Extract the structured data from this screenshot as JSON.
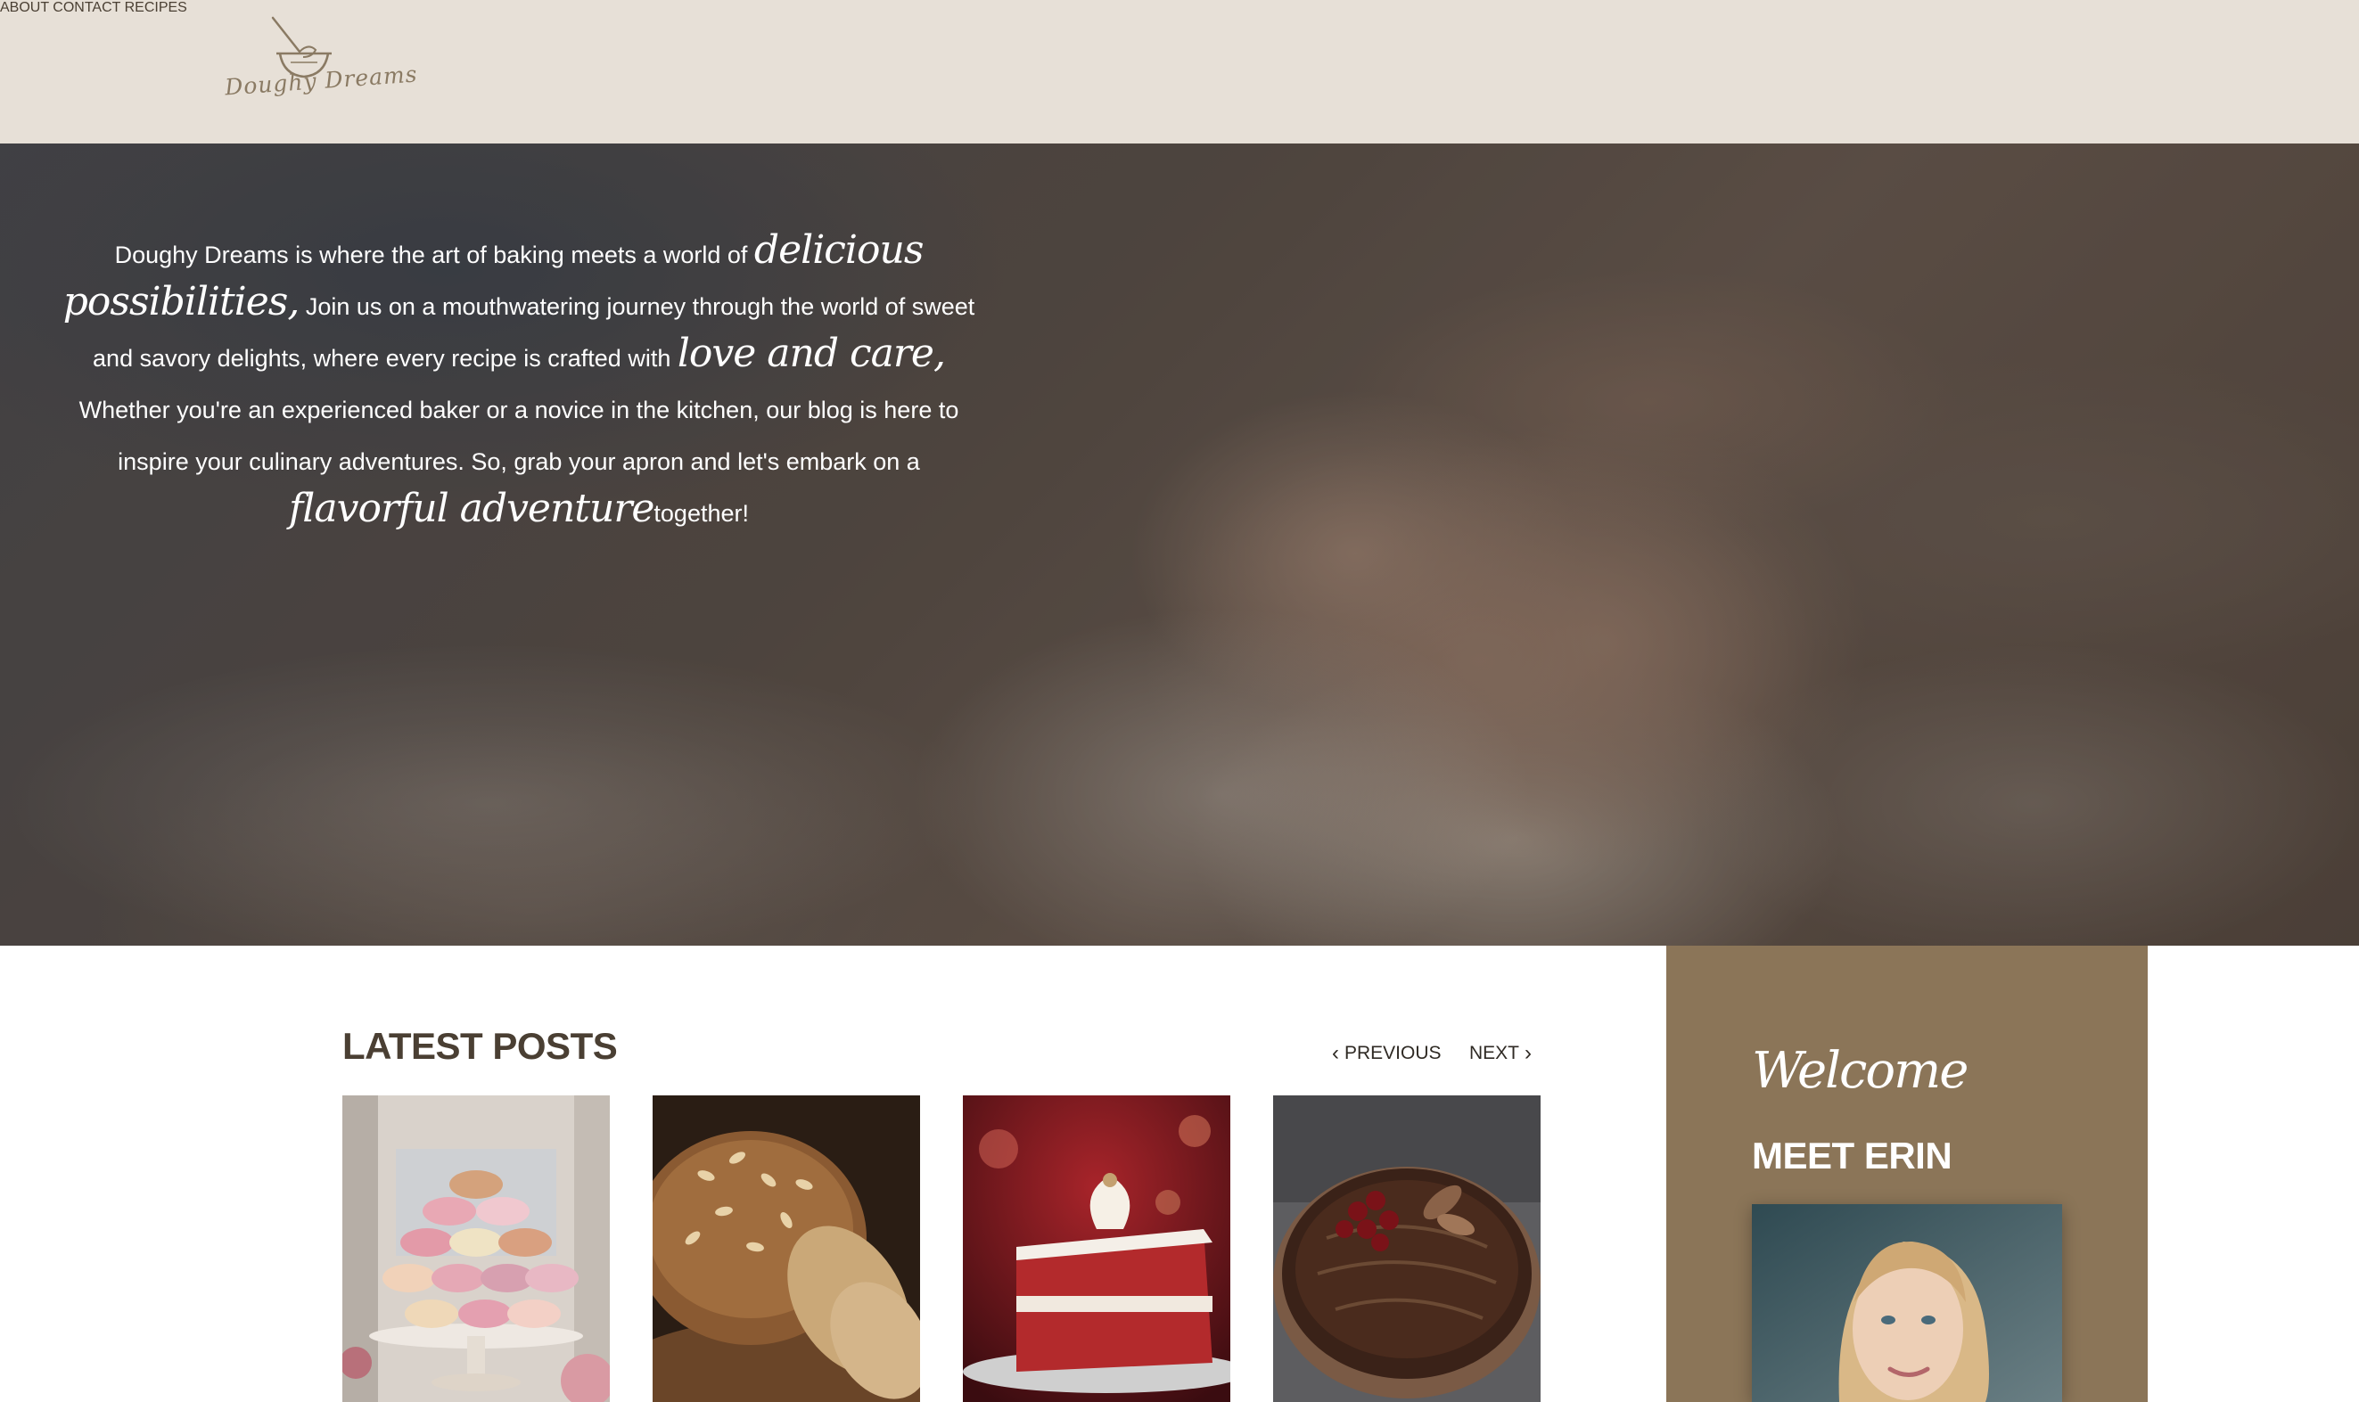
{
  "brand": {
    "logo_text": "Doughy Dreams",
    "accent_color": "#8b7558",
    "header_bg": "#e7e0d7"
  },
  "nav": {
    "items": [
      {
        "label": "ABOUT"
      },
      {
        "label": "CONTACT"
      },
      {
        "label": "RECIPES"
      }
    ]
  },
  "hero": {
    "p1": "Doughy Dreams is where the art of baking meets a world of ",
    "s1": "delicious possibilities,",
    "p2": " Join us on a mouthwatering journey through the world of sweet and savory delights, where every recipe is crafted with ",
    "s2": "love and care,",
    "p3": " Whether you're an experienced baker or a novice in the kitchen, our blog is here to inspire your culinary adventures. So, grab your apron and let's embark on a ",
    "s3": "flavorful adventure",
    "p4": "together!"
  },
  "latest_posts": {
    "title": "LATEST POSTS",
    "previous_label": "PREVIOUS",
    "next_label": "NEXT",
    "posts": [
      {
        "image": "macarons-icon"
      },
      {
        "image": "bread-icon"
      },
      {
        "image": "red-velvet-cake-icon"
      },
      {
        "image": "chocolate-cake-icon"
      }
    ]
  },
  "sidebar": {
    "welcome": "Welcome",
    "heading": "MEET ERIN",
    "portrait": "portrait-icon"
  }
}
